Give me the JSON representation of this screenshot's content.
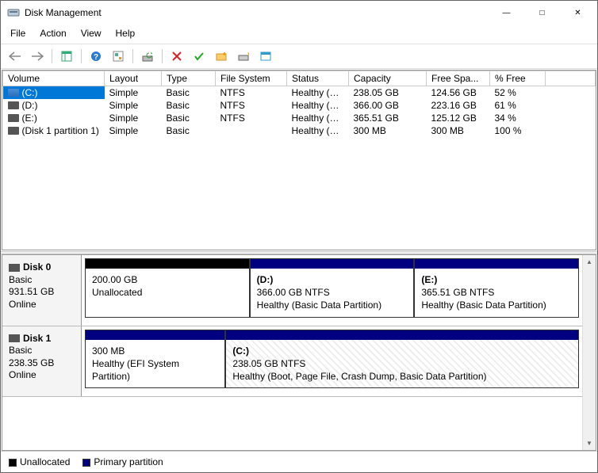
{
  "window": {
    "title": "Disk Management"
  },
  "menu": {
    "file": "File",
    "action": "Action",
    "view": "View",
    "help": "Help"
  },
  "columns": {
    "volume": "Volume",
    "layout": "Layout",
    "type": "Type",
    "fs": "File System",
    "status": "Status",
    "capacity": "Capacity",
    "free": "Free Spa...",
    "pct": "% Free"
  },
  "volumes": [
    {
      "name": "(C:)",
      "layout": "Simple",
      "type": "Basic",
      "fs": "NTFS",
      "status": "Healthy (B...",
      "capacity": "238.05 GB",
      "free": "124.56 GB",
      "pct": "52 %",
      "selected": true
    },
    {
      "name": "(D:)",
      "layout": "Simple",
      "type": "Basic",
      "fs": "NTFS",
      "status": "Healthy (B...",
      "capacity": "366.00 GB",
      "free": "223.16 GB",
      "pct": "61 %"
    },
    {
      "name": "(E:)",
      "layout": "Simple",
      "type": "Basic",
      "fs": "NTFS",
      "status": "Healthy (B...",
      "capacity": "365.51 GB",
      "free": "125.12 GB",
      "pct": "34 %"
    },
    {
      "name": "(Disk 1 partition 1)",
      "layout": "Simple",
      "type": "Basic",
      "fs": "",
      "status": "Healthy (E...",
      "capacity": "300 MB",
      "free": "300 MB",
      "pct": "100 %"
    }
  ],
  "disks": [
    {
      "name": "Disk 0",
      "type": "Basic",
      "size": "931.51 GB",
      "status": "Online",
      "parts": [
        {
          "stripe": "black",
          "l1": "",
          "l2": "200.00 GB",
          "l3": "Unallocated",
          "flex": 200
        },
        {
          "stripe": "navy",
          "l1": "(D:)",
          "l2": "366.00 GB NTFS",
          "l3": "Healthy (Basic Data Partition)",
          "flex": 200
        },
        {
          "stripe": "navy",
          "l1": "(E:)",
          "l2": "365.51 GB NTFS",
          "l3": "Healthy (Basic Data Partition)",
          "flex": 200
        }
      ]
    },
    {
      "name": "Disk 1",
      "type": "Basic",
      "size": "238.35 GB",
      "status": "Online",
      "parts": [
        {
          "stripe": "navy",
          "l1": "",
          "l2": "300 MB",
          "l3": "Healthy (EFI System Partition)",
          "flex": 170
        },
        {
          "stripe": "navy",
          "l1": "(C:)",
          "l2": "238.05 GB NTFS",
          "l3": "Healthy (Boot, Page File, Crash Dump, Basic Data Partition)",
          "flex": 430,
          "hatched": true
        }
      ]
    }
  ],
  "legend": {
    "unalloc": "Unallocated",
    "primary": "Primary partition"
  }
}
